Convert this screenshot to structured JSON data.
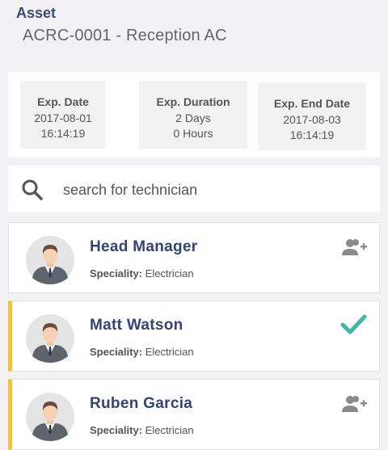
{
  "asset": {
    "label": "Asset",
    "name": "ACRC-0001 - Reception AC"
  },
  "info": [
    {
      "title": "Exp. Date",
      "line1": "2017-08-01",
      "line2": "16:14:19"
    },
    {
      "title": "Exp. Duration",
      "line1": "2 Days",
      "line2": "0 Hours"
    },
    {
      "title": "Exp. End Date",
      "line1": "2017-08-03",
      "line2": "16:14:19"
    }
  ],
  "search": {
    "placeholder": "search for technician",
    "value": ""
  },
  "technicians": [
    {
      "name": "Head Manager",
      "speciality_label": "Speciality:",
      "speciality": "Electrician",
      "status": "add",
      "action_icon": "add-user-icon",
      "highlight": false
    },
    {
      "name": "Matt Watson",
      "speciality_label": "Speciality:",
      "speciality": "Electrician",
      "status": "assigned",
      "action_icon": "check-icon",
      "highlight": true
    },
    {
      "name": "Ruben Garcia",
      "speciality_label": "Speciality:",
      "speciality": "Electrician",
      "status": "add",
      "action_icon": "add-user-icon",
      "highlight": true
    }
  ],
  "colors": {
    "accent_bar": "#f6c232",
    "name_text": "#34427a",
    "check": "#3fb8a3",
    "icon_gray": "#8a8a8a"
  }
}
